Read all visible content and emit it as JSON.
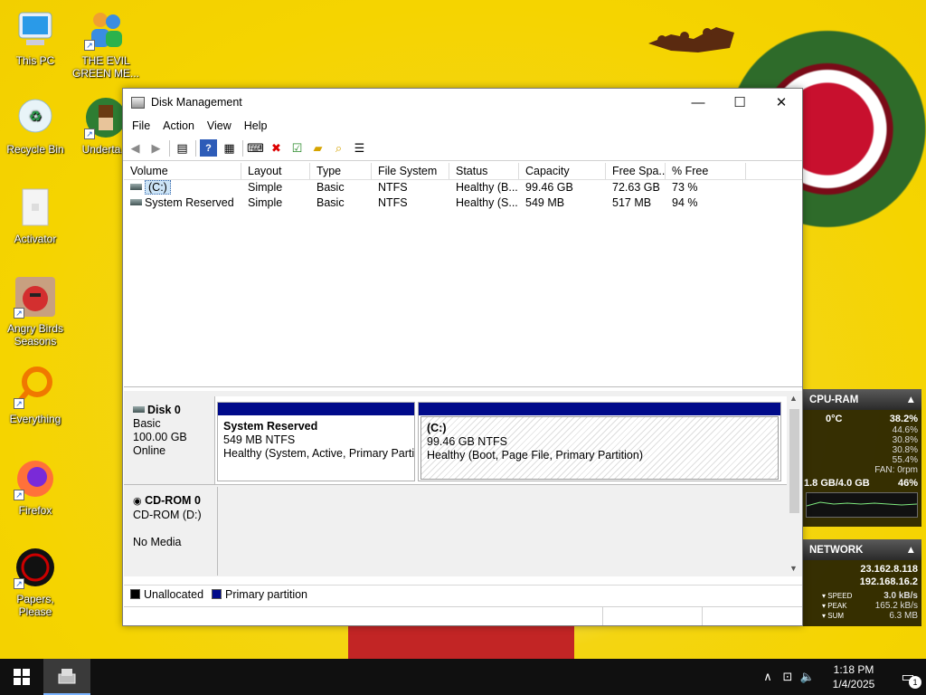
{
  "desktop": {
    "icons": [
      {
        "label": "This PC"
      },
      {
        "label": "THE EVIL GREEN ME..."
      },
      {
        "label": "Recycle Bin"
      },
      {
        "label": "Underta..."
      },
      {
        "label": "Activator"
      },
      {
        "label": "Angry Birds Seasons"
      },
      {
        "label": "Everything"
      },
      {
        "label": "Firefox"
      },
      {
        "label": "Papers, Please"
      }
    ]
  },
  "window": {
    "title": "Disk Management",
    "menu": [
      "File",
      "Action",
      "View",
      "Help"
    ],
    "columns": [
      "Volume",
      "Layout",
      "Type",
      "File System",
      "Status",
      "Capacity",
      "Free Spa...",
      "% Free"
    ],
    "volumes": [
      {
        "volume": "(C:)",
        "layout": "Simple",
        "type": "Basic",
        "fs": "NTFS",
        "status": "Healthy (B...",
        "capacity": "99.46 GB",
        "free": "72.63 GB",
        "pct": "73 %"
      },
      {
        "volume": "System Reserved",
        "layout": "Simple",
        "type": "Basic",
        "fs": "NTFS",
        "status": "Healthy (S...",
        "capacity": "549 MB",
        "free": "517 MB",
        "pct": "94 %"
      }
    ],
    "disk0": {
      "name": "Disk 0",
      "type": "Basic",
      "size": "100.00 GB",
      "state": "Online",
      "partitions": [
        {
          "name": "System Reserved",
          "size": "549 MB NTFS",
          "status": "Healthy (System, Active, Primary Partiti"
        },
        {
          "name": "(C:)",
          "size": "99.46 GB NTFS",
          "status": "Healthy (Boot, Page File, Primary Partition)"
        }
      ]
    },
    "cdrom0": {
      "name": "CD-ROM 0",
      "type": "CD-ROM (D:)",
      "media": "No Media"
    },
    "legend": [
      {
        "label": "Unallocated",
        "color": "#000000"
      },
      {
        "label": "Primary partition",
        "color": "#000a8a"
      }
    ]
  },
  "cpu_gadget": {
    "title": "CPU-RAM",
    "temp": "0°C",
    "usage": "38.2%",
    "cores": [
      "44.6%",
      "30.8%",
      "30.8%",
      "55.4%"
    ],
    "fan": "FAN: 0rpm",
    "ram": "1.8 GB/4.0 GB",
    "ram_pct": "46%"
  },
  "network_gadget": {
    "title": "NETWORK",
    "ip_external": "23.162.8.118",
    "ip_internal": "192.168.16.2",
    "speed_label": "SPEED",
    "speed": "3.0 kB/s",
    "peak_label": "PEAK",
    "peak": "165.2 kB/s",
    "sum_label": "SUM",
    "sum": "6.3 MB"
  },
  "taskbar": {
    "time": "1:18 PM",
    "date": "1/4/2025",
    "notifications": "1"
  }
}
